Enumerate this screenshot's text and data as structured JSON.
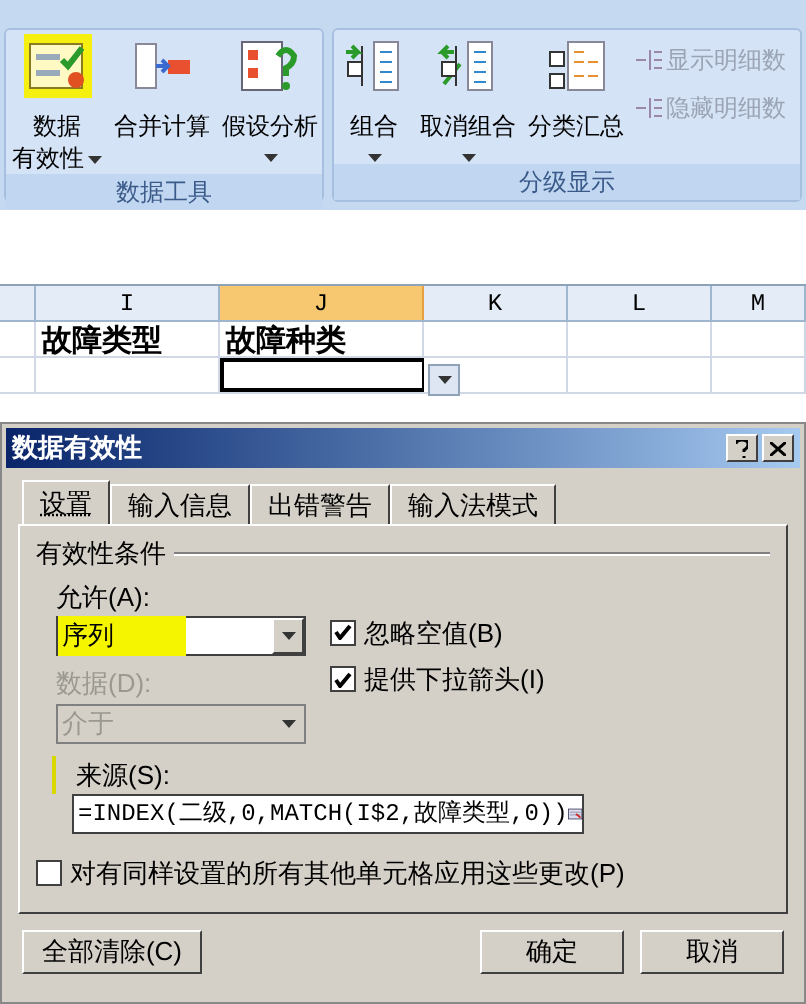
{
  "ribbon": {
    "groups": [
      {
        "label": "数据工具",
        "buttons": [
          {
            "kind": "validate",
            "lines": [
              "数据",
              "有效性"
            ],
            "dropdown": true,
            "highlighted": true
          },
          {
            "kind": "merge",
            "lines": [
              "合并计算"
            ],
            "dropdown": false,
            "highlighted": false
          },
          {
            "kind": "whatif",
            "lines": [
              "假设分析"
            ],
            "dropdown": true,
            "highlighted": false
          }
        ]
      },
      {
        "label": "分级显示",
        "buttons": [
          {
            "kind": "group",
            "lines": [
              "组合"
            ],
            "dropdown": true,
            "highlighted": false
          },
          {
            "kind": "ungroup",
            "lines": [
              "取消组合"
            ],
            "dropdown": true,
            "highlighted": false
          },
          {
            "kind": "subtotal",
            "lines": [
              "分类汇总"
            ],
            "dropdown": false,
            "highlighted": false
          }
        ],
        "small": [
          {
            "label": "显示明细数",
            "disabled": true
          },
          {
            "label": "隐藏明细数",
            "disabled": true
          }
        ]
      }
    ]
  },
  "sheet": {
    "columns": [
      {
        "label": "I",
        "selected": false
      },
      {
        "label": "J",
        "selected": true
      },
      {
        "label": "K",
        "selected": false
      },
      {
        "label": "L",
        "selected": false
      },
      {
        "label": "M",
        "selected": false
      }
    ],
    "rows": [
      [
        "故障类型",
        "故障种类",
        "",
        "",
        ""
      ],
      [
        "",
        "",
        "",
        "",
        ""
      ]
    ]
  },
  "dialog": {
    "title": "数据有效性",
    "tabs": [
      {
        "label": "设置",
        "selected": true
      },
      {
        "label": "输入信息",
        "selected": false
      },
      {
        "label": "出错警告",
        "selected": false
      },
      {
        "label": "输入法模式",
        "selected": false
      }
    ],
    "group_title": "有效性条件",
    "allow_label": "允许(A):",
    "allow_value": "序列",
    "data_label": "数据(D):",
    "data_value": "介于",
    "data_disabled": true,
    "checks": [
      {
        "label": "忽略空值(B)",
        "checked": true
      },
      {
        "label": "提供下拉箭头(I)",
        "checked": true
      }
    ],
    "source_label": "来源(S):",
    "source_value": "=INDEX(二级,0,MATCH(I$2,故障类型,0))",
    "apply_all": {
      "label": "对有同样设置的所有其他单元格应用这些更改(P)",
      "checked": false
    },
    "buttons": [
      "全部清除(C)",
      "确定",
      "取消"
    ]
  }
}
